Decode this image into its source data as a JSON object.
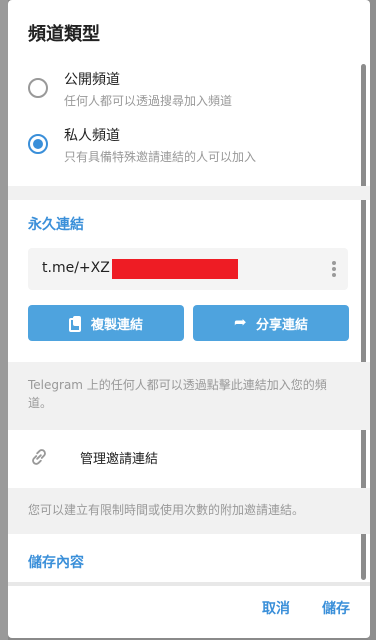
{
  "dialog": {
    "title": "頻道類型"
  },
  "channel_type": {
    "options": [
      {
        "label": "公開頻道",
        "desc": "任何人都可以透過搜尋加入頻道",
        "selected": false
      },
      {
        "label": "私人頻道",
        "desc": "只有具備特殊邀請連結的人可以加入",
        "selected": true
      }
    ]
  },
  "permanent_link": {
    "header": "永久連結",
    "link_prefix": "t.me/+XZ",
    "more_icon": "kebab-menu-icon",
    "copy_label": "複製連結",
    "copy_icon": "copy-icon",
    "share_label": "分享連結",
    "share_icon": "share-icon",
    "info": "Telegram 上的任何人都可以透過點擊此連結加入您的頻道。"
  },
  "invite_links": {
    "manage_label": "管理邀請連結",
    "manage_icon": "link-icon",
    "info": "您可以建立有限制時間或使用次數的附加邀請連結。"
  },
  "saved_content": {
    "header": "儲存內容"
  },
  "footer": {
    "cancel_label": "取消",
    "save_label": "儲存"
  },
  "colors": {
    "accent": "#3a8fd9",
    "button": "#4ea3de",
    "redaction": "#ee1c24"
  }
}
